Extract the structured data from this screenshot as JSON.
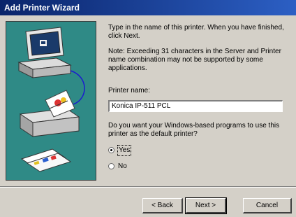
{
  "window": {
    "title": "Add Printer Wizard"
  },
  "content": {
    "intro": "Type in the name of this printer. When you have finished, click Next.",
    "note": "Note: Exceeding 31 characters in the Server and Printer name combination may not be supported by some applications.",
    "printer_name_label": "Printer name:",
    "printer_name_value": "Konica IP-511 PCL",
    "default_question": "Do you want your Windows-based programs to use this printer as the default printer?",
    "radio_yes": "Yes",
    "radio_no": "No",
    "selected": "Yes"
  },
  "buttons": {
    "back": "< Back",
    "next": "Next >",
    "cancel": "Cancel"
  }
}
